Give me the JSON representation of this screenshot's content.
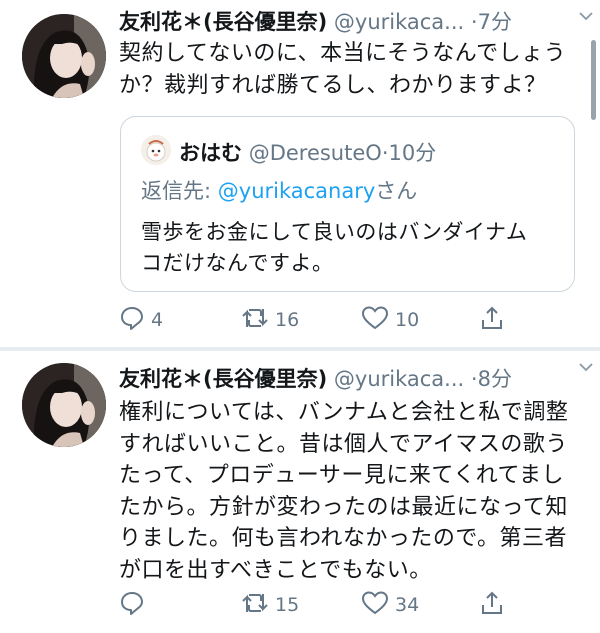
{
  "tweets": [
    {
      "name": "友利花＊(長谷優里奈)",
      "handle": "@yurikaca...",
      "separator": "·",
      "time": "7分",
      "text_lines": [
        "契約してないのに、本当にそうなんでしょう",
        "か？裁判すれば勝てるし、わかりますよ？"
      ],
      "quote": {
        "name": "おはむ",
        "handle": "@DeresuteO",
        "separator": "·",
        "time": "10分",
        "reply_prefix": "返信先: ",
        "reply_handle": "@yurikacanary",
        "reply_suffix": "さん",
        "text_lines": [
          "雪歩をお金にして良いのはバンダイナム",
          "コだけなんですよ。"
        ]
      },
      "actions": {
        "reply": "4",
        "retweet": "16",
        "like": "10"
      }
    },
    {
      "name": "友利花＊(長谷優里奈)",
      "handle": "@yurikaca...",
      "separator": "·",
      "time": "8分",
      "text_lines": [
        "権利については、バンナムと会社と私で調整",
        "すればいいこと。昔は個人でアイマスの歌う",
        "たって、プロデューサー見に来てくれてまし",
        "たから。方針が変わったのは最近になって知",
        "りました。何も言われなかったので。第三者",
        "が口を出すべきことでもない。"
      ],
      "actions": {
        "reply": "",
        "retweet": "15",
        "like": "34"
      }
    }
  ],
  "icons": {
    "reply": "reply-icon",
    "retweet": "retweet-icon",
    "like": "heart-icon",
    "share": "share-icon",
    "menu": "chevron-down-icon"
  },
  "colors": {
    "text": "#14171a",
    "secondary": "#657786",
    "link": "#1da1f2",
    "border": "#ccd6dd",
    "divider": "#e6ecf0"
  }
}
